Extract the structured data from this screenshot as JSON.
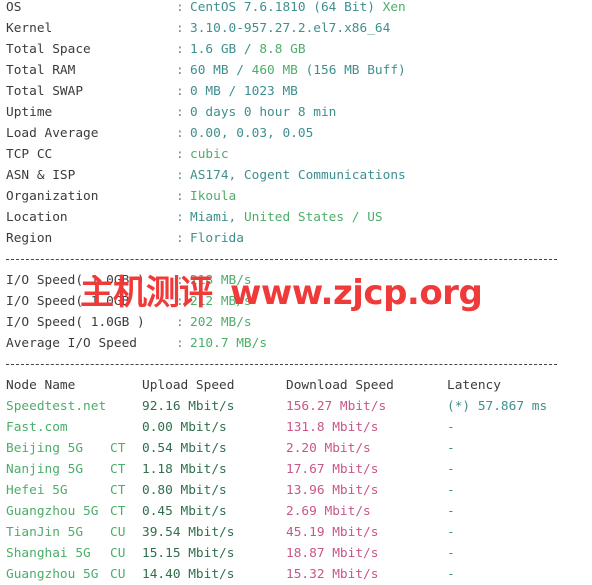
{
  "system_info": {
    "separator": ":",
    "rows": [
      {
        "label": "OS",
        "parts": [
          {
            "text": "CentOS 7.6.1810 (64 Bit) ",
            "color": "teal"
          },
          {
            "text": "Xen",
            "color": "green"
          }
        ]
      },
      {
        "label": "Kernel",
        "parts": [
          {
            "text": "3.10.0-957.27.2.el7.x86_64",
            "color": "teal"
          }
        ]
      },
      {
        "label": "Total Space",
        "parts": [
          {
            "text": "1.6 GB / ",
            "color": "teal"
          },
          {
            "text": "8.8 GB",
            "color": "green"
          }
        ]
      },
      {
        "label": "Total RAM",
        "parts": [
          {
            "text": "60 MB / ",
            "color": "teal"
          },
          {
            "text": "460 MB",
            "color": "green"
          },
          {
            "text": " (156 MB Buff)",
            "color": "teal"
          }
        ]
      },
      {
        "label": "Total SWAP",
        "parts": [
          {
            "text": "0 MB / 1023 MB",
            "color": "teal"
          }
        ]
      },
      {
        "label": "Uptime",
        "parts": [
          {
            "text": "0 days 0 hour 8 min",
            "color": "teal"
          }
        ]
      },
      {
        "label": "Load Average",
        "parts": [
          {
            "text": "0.00, 0.03, 0.05",
            "color": "teal"
          }
        ]
      },
      {
        "label": "TCP CC",
        "parts": [
          {
            "text": "cubic",
            "color": "green"
          }
        ]
      },
      {
        "label": "ASN & ISP",
        "parts": [
          {
            "text": "AS174, Cogent Communications",
            "color": "teal"
          }
        ]
      },
      {
        "label": "Organization",
        "parts": [
          {
            "text": "Ikoula",
            "color": "green"
          }
        ]
      },
      {
        "label": "Location",
        "parts": [
          {
            "text": "Miami, ",
            "color": "teal"
          },
          {
            "text": "United States / US",
            "color": "green"
          }
        ]
      },
      {
        "label": "Region",
        "parts": [
          {
            "text": "Florida",
            "color": "teal"
          }
        ]
      }
    ]
  },
  "io_info": {
    "rows": [
      {
        "label": "I/O Speed( 1.0GB )",
        "value": "218 MB/s"
      },
      {
        "label": "I/O Speed( 1.0GB )",
        "value": "212 MB/s"
      },
      {
        "label": "I/O Speed( 1.0GB )",
        "value": "202 MB/s"
      },
      {
        "label": "Average I/O Speed",
        "value": "210.7 MB/s"
      }
    ]
  },
  "speed_table": {
    "headers": {
      "node": "Node Name",
      "upload": "Upload Speed",
      "download": "Download Speed",
      "latency": "Latency"
    },
    "rows": [
      {
        "node": "Speedtest.net",
        "isp": "",
        "upload": "92.16 Mbit/s",
        "download": "156.27 Mbit/s",
        "latency": "(*) 57.867 ms"
      },
      {
        "node": "Fast.com",
        "isp": "",
        "upload": "0.00 Mbit/s",
        "download": "131.8 Mbit/s",
        "latency": "-"
      },
      {
        "node": "Beijing 5G",
        "isp": "CT",
        "upload": "0.54 Mbit/s",
        "download": "2.20 Mbit/s",
        "latency": "-"
      },
      {
        "node": "Nanjing 5G",
        "isp": "CT",
        "upload": "1.18 Mbit/s",
        "download": "17.67 Mbit/s",
        "latency": "-"
      },
      {
        "node": "Hefei 5G",
        "isp": "CT",
        "upload": "0.80 Mbit/s",
        "download": "13.96 Mbit/s",
        "latency": "-"
      },
      {
        "node": "Guangzhou 5G",
        "isp": "CT",
        "upload": "0.45 Mbit/s",
        "download": "2.69 Mbit/s",
        "latency": "-"
      },
      {
        "node": "TianJin 5G",
        "isp": "CU",
        "upload": "39.54 Mbit/s",
        "download": "45.19 Mbit/s",
        "latency": "-"
      },
      {
        "node": "Shanghai 5G",
        "isp": "CU",
        "upload": "15.15 Mbit/s",
        "download": "18.87 Mbit/s",
        "latency": "-"
      },
      {
        "node": "Guangzhou 5G",
        "isp": "CU",
        "upload": "14.40 Mbit/s",
        "download": "15.32 Mbit/s",
        "latency": "-"
      }
    ]
  },
  "watermark": {
    "cn": "主机测评",
    "url": "www.zjcp.org"
  },
  "colors": {
    "teal": "#3f8f8f",
    "green": "#4cae6a",
    "upload_green": "#2f6f4c",
    "download_pink": "#c9568a",
    "watermark_red": "#f03a3a"
  }
}
